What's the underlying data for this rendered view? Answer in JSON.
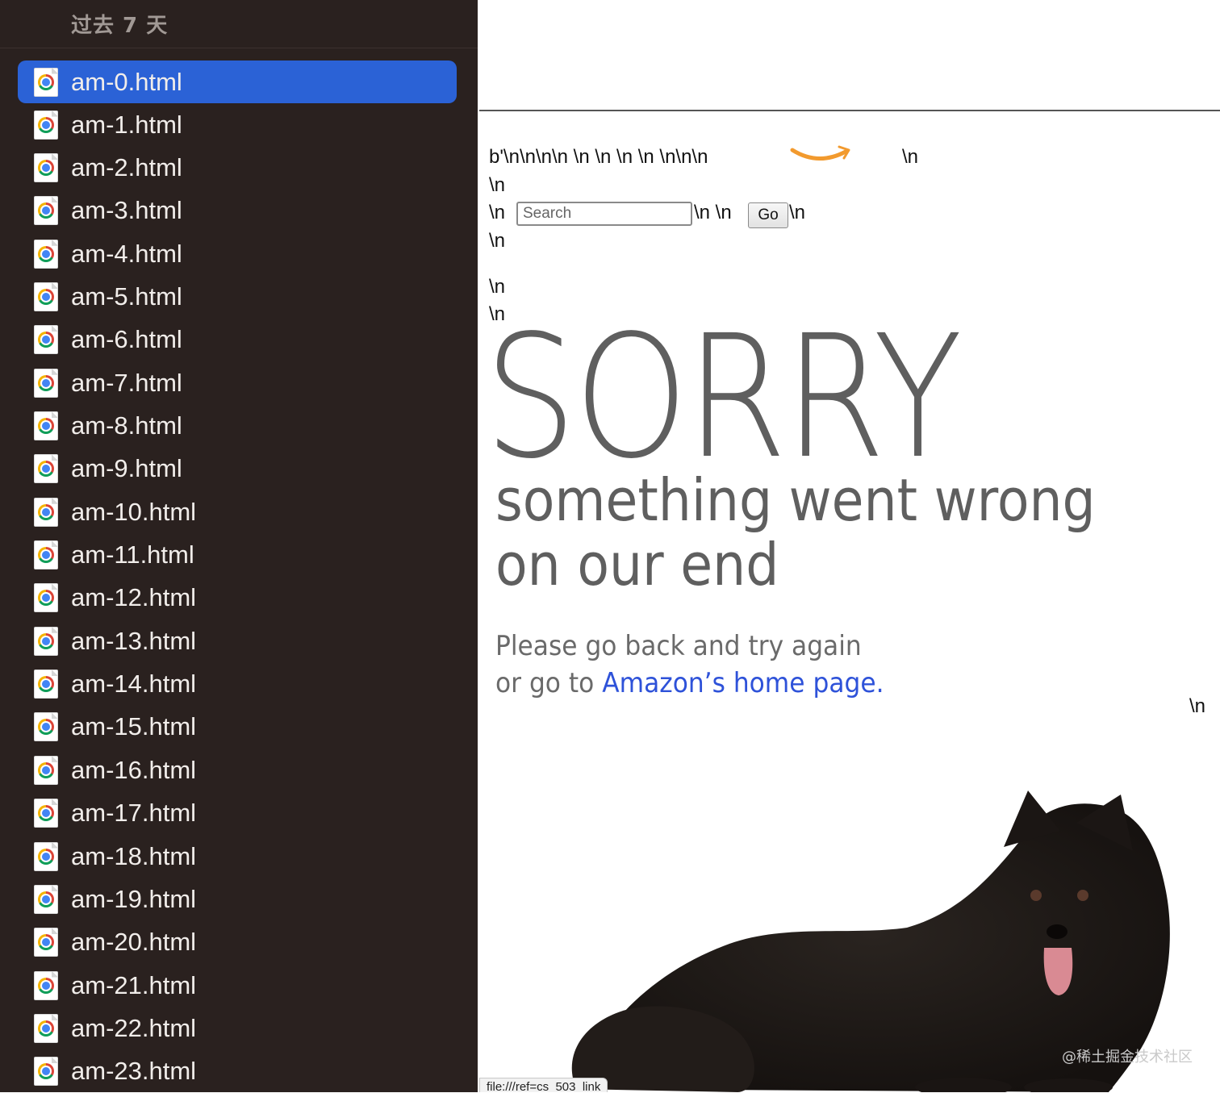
{
  "sidebar": {
    "section_title": "过去 7 天",
    "files": [
      "am-0.html",
      "am-1.html",
      "am-2.html",
      "am-3.html",
      "am-4.html",
      "am-5.html",
      "am-6.html",
      "am-7.html",
      "am-8.html",
      "am-9.html",
      "am-10.html",
      "am-11.html",
      "am-12.html",
      "am-13.html",
      "am-14.html",
      "am-15.html",
      "am-16.html",
      "am-17.html",
      "am-18.html",
      "am-19.html",
      "am-20.html",
      "am-21.html",
      "am-22.html",
      "am-23.html"
    ],
    "selected_index": 0,
    "icon": "chrome-html-file-icon",
    "colors": {
      "background": "#2a211f",
      "selection": "#2b62d6"
    }
  },
  "page": {
    "raw_line_1": "b'\\n\\n\\n\\n \\n \\n \\n \\n \\n\\n\\n",
    "raw_line_1_tail": "\\n",
    "raw_line_2": "\\n",
    "raw_line_3_pre": "\\n",
    "search_placeholder": "Search",
    "raw_line_3_mid": "\\n \\n",
    "go_label": "Go",
    "raw_line_3_post": "\\n",
    "raw_line_4": "\\n",
    "raw_line_5": "\\n",
    "raw_line_6": "\\n",
    "sorry_heading": "SORRY",
    "subheading_1": "something went wrong",
    "subheading_2": "on our end",
    "message_1": "Please go back and try again",
    "message_2_prefix": "or go to ",
    "message_2_link": "Amazon’s home page.",
    "raw_line_right": "\\n",
    "link_color": "#2e52d9",
    "logo_color": "#f29a2e"
  },
  "status_bar": {
    "url": "file:///ref=cs_503_link"
  },
  "watermark": "@稀土掘金技术社区"
}
